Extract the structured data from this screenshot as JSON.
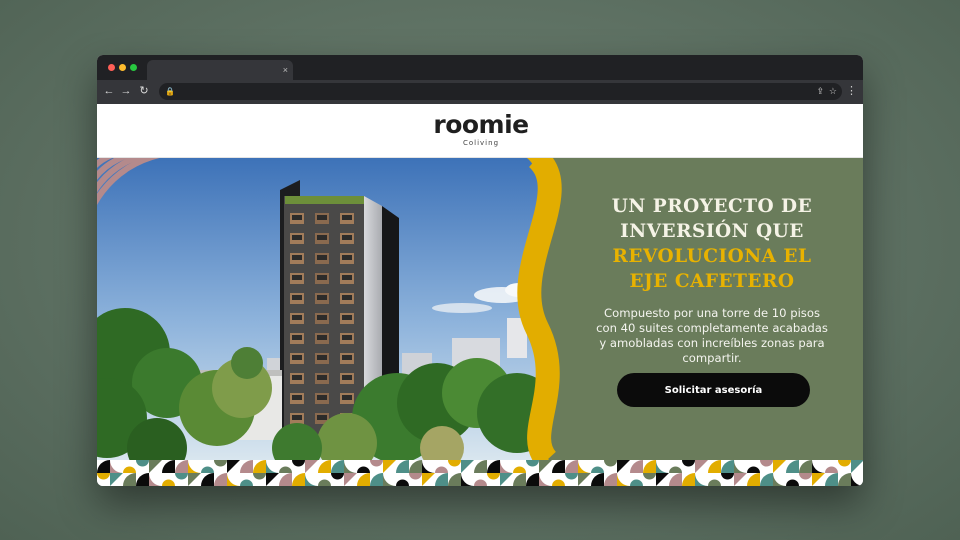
{
  "browser": {
    "tab_close_glyph": "×",
    "nav": {
      "back": "←",
      "forward": "→",
      "reload": "↻"
    },
    "url_icons": {
      "lock": "🔒",
      "share": "⇪",
      "star": "☆"
    },
    "menu_glyph": "⋮"
  },
  "site": {
    "logo_text": "roomie",
    "logo_subtitle": "Coliving",
    "colors": {
      "olive": "#6a7c5b",
      "gold": "#e2ad00",
      "mauve": "#b48a8c",
      "dark": "#0b0b0b",
      "teal": "#4e8f88"
    }
  },
  "hero": {
    "title_line1": "UN PROYECTO DE",
    "title_line2": "INVERSIÓN QUE",
    "title_line3": "REVOLUCIONA EL",
    "title_line4": "EJE CAFETERO",
    "description": "Compuesto por una torre de 10 pisos con 40 suites completamente acabadas y amobladas  con increíbles zonas para compartir.",
    "cta_label": "Solicitar asesoría"
  }
}
